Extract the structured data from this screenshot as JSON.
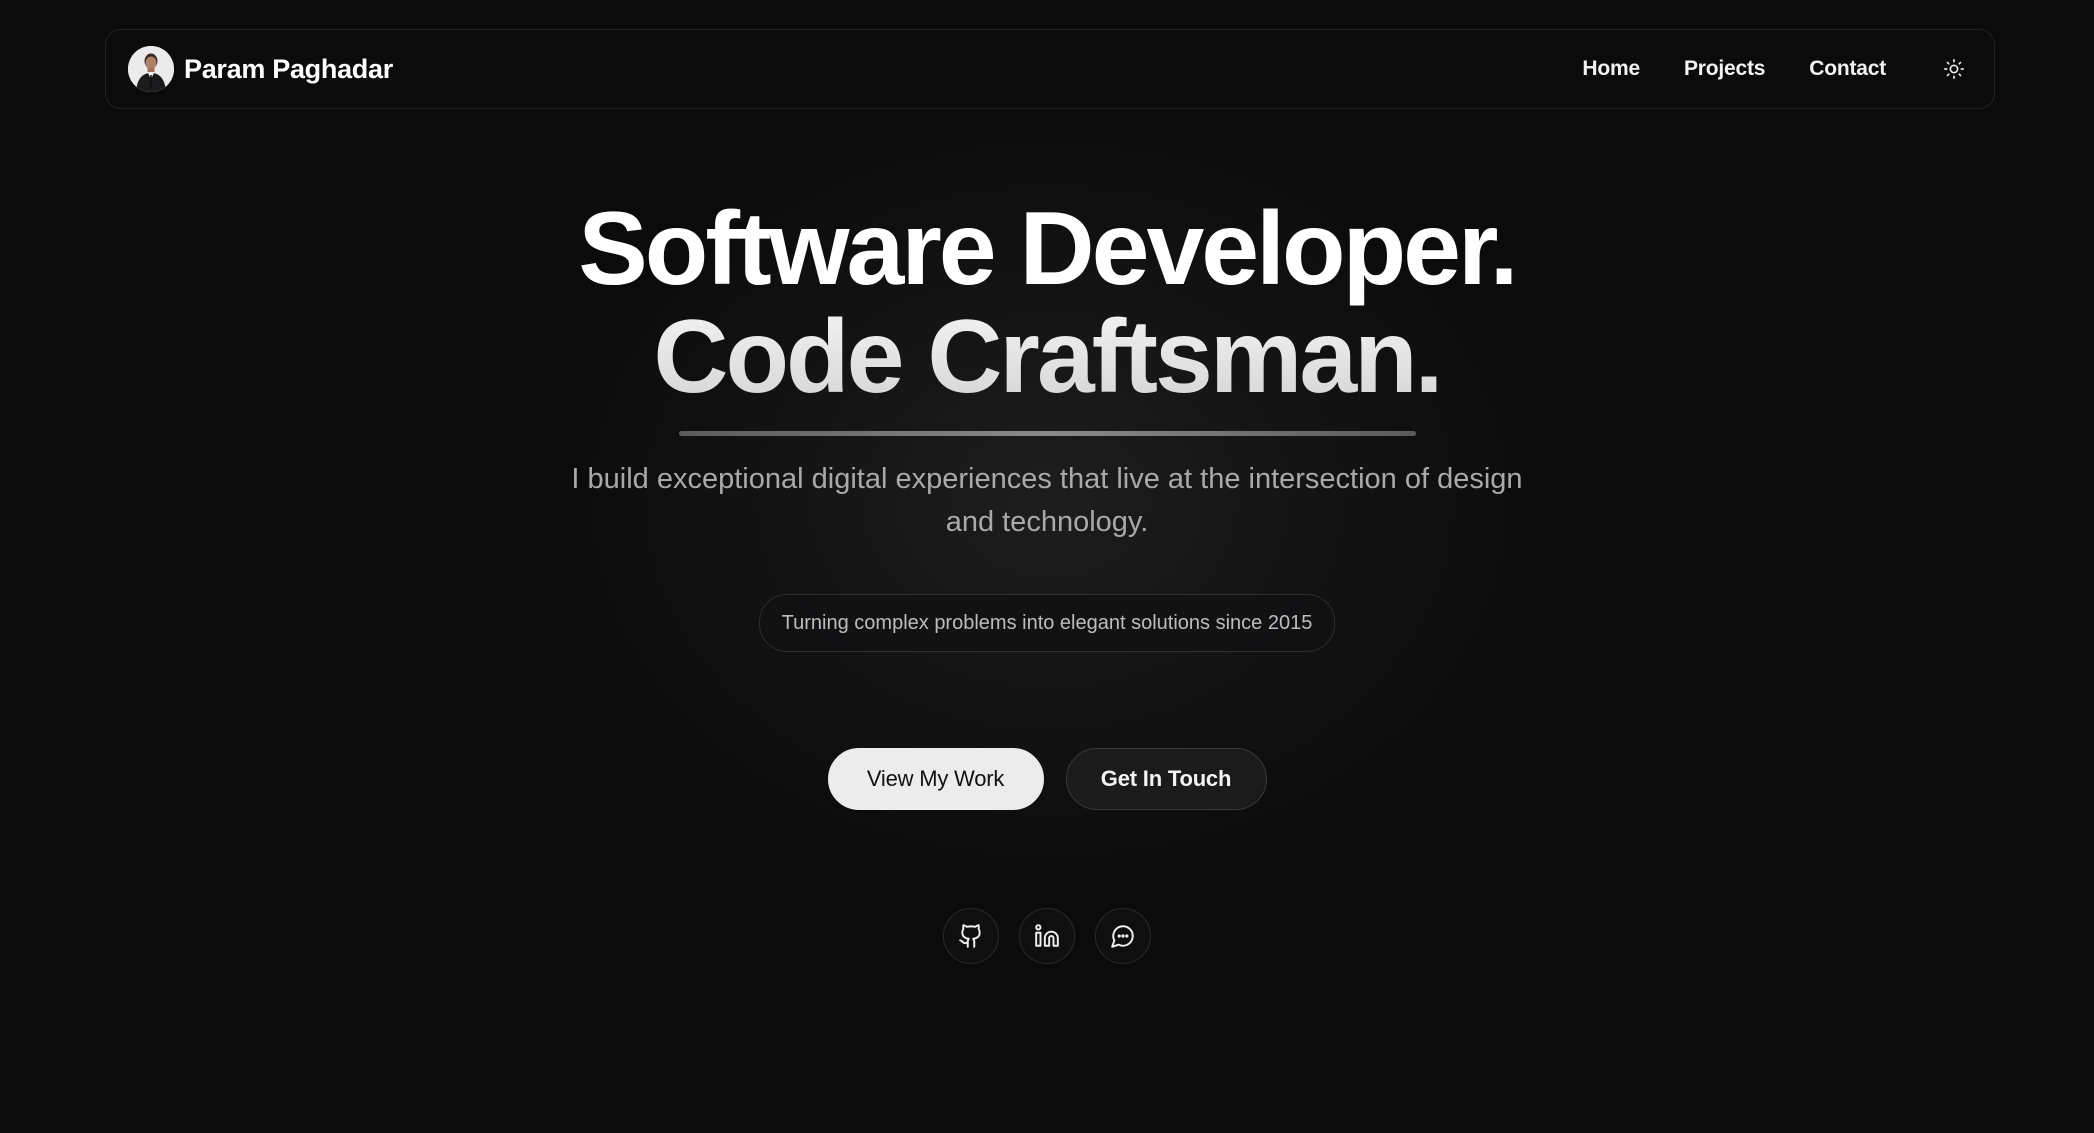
{
  "brand": {
    "name": "Param Paghadar",
    "avatar_icon": "avatar-icon"
  },
  "nav": {
    "links": [
      {
        "label": "Home"
      },
      {
        "label": "Projects"
      },
      {
        "label": "Contact"
      }
    ],
    "theme_toggle_icon": "sun-icon"
  },
  "hero": {
    "headline_line1": "Software Developer.",
    "headline_line2": "Code Craftsman.",
    "subtitle": "I build exceptional digital experiences that live at the intersection of design and technology.",
    "tagline": "Turning complex problems into elegant solutions since 2015"
  },
  "cta": {
    "primary_label": "View My Work",
    "secondary_label": "Get In Touch"
  },
  "social": {
    "icons": [
      "github-icon",
      "linkedin-icon",
      "message-icon"
    ]
  },
  "colors": {
    "background": "#0b0b0c",
    "text_primary": "#ffffff",
    "text_muted": "#a9a9ab",
    "button_primary_bg": "#ececec"
  }
}
